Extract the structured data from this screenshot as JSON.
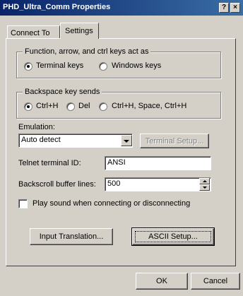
{
  "window": {
    "title": "PHD_Ultra_Comm Properties",
    "help": "?",
    "close": "×"
  },
  "tabs": [
    {
      "label": "Connect To"
    },
    {
      "label": "Settings"
    }
  ],
  "keys_group": {
    "legend": "Function, arrow, and ctrl keys act as",
    "options": [
      {
        "label": "Terminal keys",
        "selected": true
      },
      {
        "label": "Windows keys",
        "selected": false
      }
    ]
  },
  "backspace_group": {
    "legend": "Backspace key sends",
    "options": [
      {
        "label": "Ctrl+H",
        "selected": true
      },
      {
        "label": "Del",
        "selected": false
      },
      {
        "label": "Ctrl+H, Space, Ctrl+H",
        "selected": false
      }
    ]
  },
  "emulation": {
    "label": "Emulation:",
    "value": "Auto detect",
    "setup_button": "Terminal Setup..."
  },
  "telnet": {
    "label": "Telnet terminal ID:",
    "value": "ANSI"
  },
  "backscroll": {
    "label": "Backscroll buffer lines:",
    "value": "500"
  },
  "play_sound": {
    "label": "Play sound when connecting or disconnecting",
    "checked": false
  },
  "buttons": {
    "input_translation": "Input Translation...",
    "ascii_setup": "ASCII Setup...",
    "ok": "OK",
    "cancel": "Cancel"
  }
}
